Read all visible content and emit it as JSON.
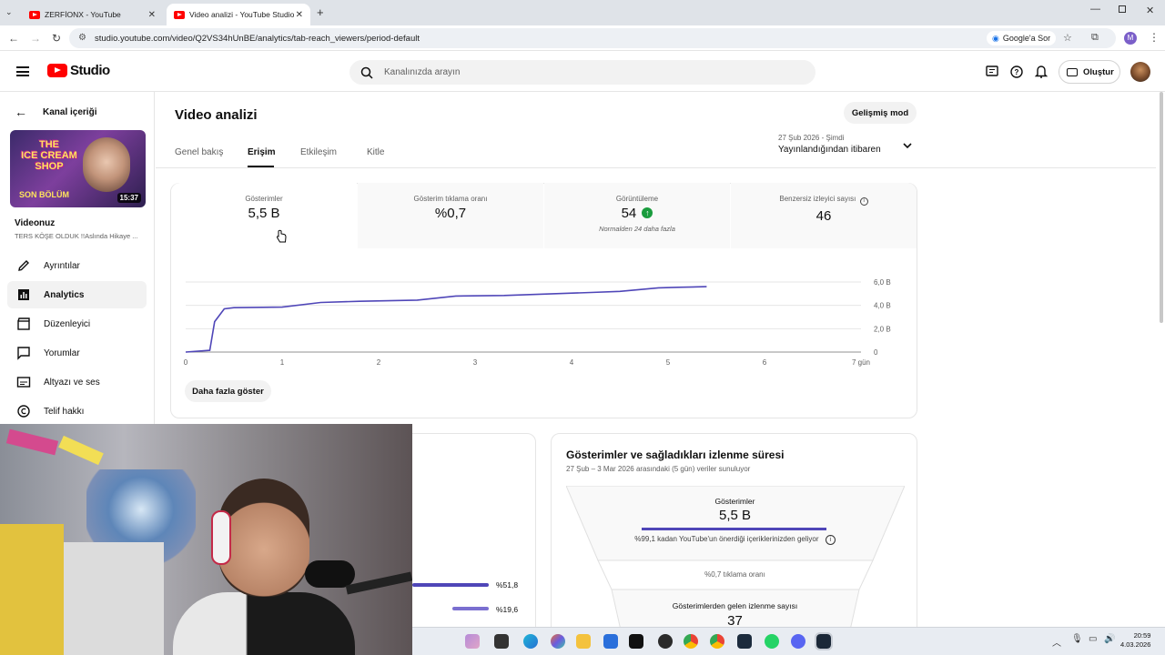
{
  "browser": {
    "tabs": [
      {
        "label": "ZERFİONX - YouTube"
      },
      {
        "label": "Video analizi - YouTube Studio"
      }
    ],
    "url": "studio.youtube.com/video/Q2VS34hUnBE/analytics/tab-reach_viewers/period-default",
    "google_lens": "Google'a Sor"
  },
  "header": {
    "logo": "Studio",
    "search_placeholder": "Kanalınızda arayın",
    "create_label": "Oluştur"
  },
  "sidebar": {
    "back_label": "Kanal içeriği",
    "thumb_title_1": "THE",
    "thumb_title_2": "ICE CREAM",
    "thumb_title_3": "SHOP",
    "thumb_sub": "SON BÖLÜM",
    "thumb_duration": "15:37",
    "video_heading": "Videonuz",
    "video_title": "TERS KÖŞE OLDUK !!Aslında Hikaye ...",
    "items": [
      {
        "label": "Ayrıntılar"
      },
      {
        "label": "Analytics"
      },
      {
        "label": "Düzenleyici"
      },
      {
        "label": "Yorumlar"
      },
      {
        "label": "Altyazı ve ses"
      },
      {
        "label": "Telif hakkı"
      }
    ]
  },
  "main": {
    "title": "Video analizi",
    "advanced_button": "Gelişmiş mod",
    "tabs": [
      {
        "label": "Genel bakış"
      },
      {
        "label": "Erişim"
      },
      {
        "label": "Etkileşim"
      },
      {
        "label": "Kitle"
      }
    ],
    "period_range": "27 Şub 2026 - Şimdi",
    "period_label": "Yayınlandığından itibaren",
    "metrics": [
      {
        "label": "Gösterimler",
        "value": "5,5 B"
      },
      {
        "label": "Gösterim tıklama oranı",
        "value": "%0,7"
      },
      {
        "label": "Görüntüleme",
        "value": "54",
        "note": "Normalden 24 daha fazla"
      },
      {
        "label": "Benzersiz izleyici sayısı",
        "value": "46"
      }
    ],
    "show_more": "Daha fazla göster"
  },
  "chart_data": {
    "type": "line",
    "x_tick_labels": [
      "0",
      "1",
      "2",
      "3",
      "4",
      "5",
      "6",
      "7 gün"
    ],
    "y_tick_labels": [
      "0",
      "2,0 B",
      "4,0 B",
      "6,0 B"
    ],
    "xlim": [
      0,
      7
    ],
    "ylim": [
      0,
      6000
    ],
    "grid": true,
    "series": [
      {
        "color": "#4f46b8",
        "x": [
          0,
          0.25,
          0.3,
          0.4,
          0.5,
          1.0,
          1.4,
          1.8,
          2.4,
          2.8,
          3.3,
          4.2,
          4.5,
          4.9,
          5.1,
          5.4
        ],
        "y": [
          0,
          150,
          2600,
          3700,
          3800,
          3850,
          4250,
          4350,
          4450,
          4800,
          4850,
          5100,
          5200,
          5500,
          5550,
          5600
        ]
      }
    ]
  },
  "funnel": {
    "title": "Gösterimler ve sağladıkları izlenme süresi",
    "subtitle": "27 Şub – 3 Mar 2026 arasındaki (5 gün) veriler sunuluyor",
    "impressions_label": "Gösterimler",
    "impressions_value": "5,5 B",
    "impressions_note": "%99,1 kadan YouTube'un önerdiği içeriklerinizden geliyor",
    "ctr_label": "%0,7 tıklama oranı",
    "views_label": "Gösterimlerden gelen izlenme sayısı",
    "views_value": "37"
  },
  "traffic": {
    "bars": [
      {
        "percent": "%51,8"
      },
      {
        "percent": "%19,6"
      }
    ]
  },
  "taskbar": {
    "time": "20:59",
    "date": "4.03.2026"
  }
}
